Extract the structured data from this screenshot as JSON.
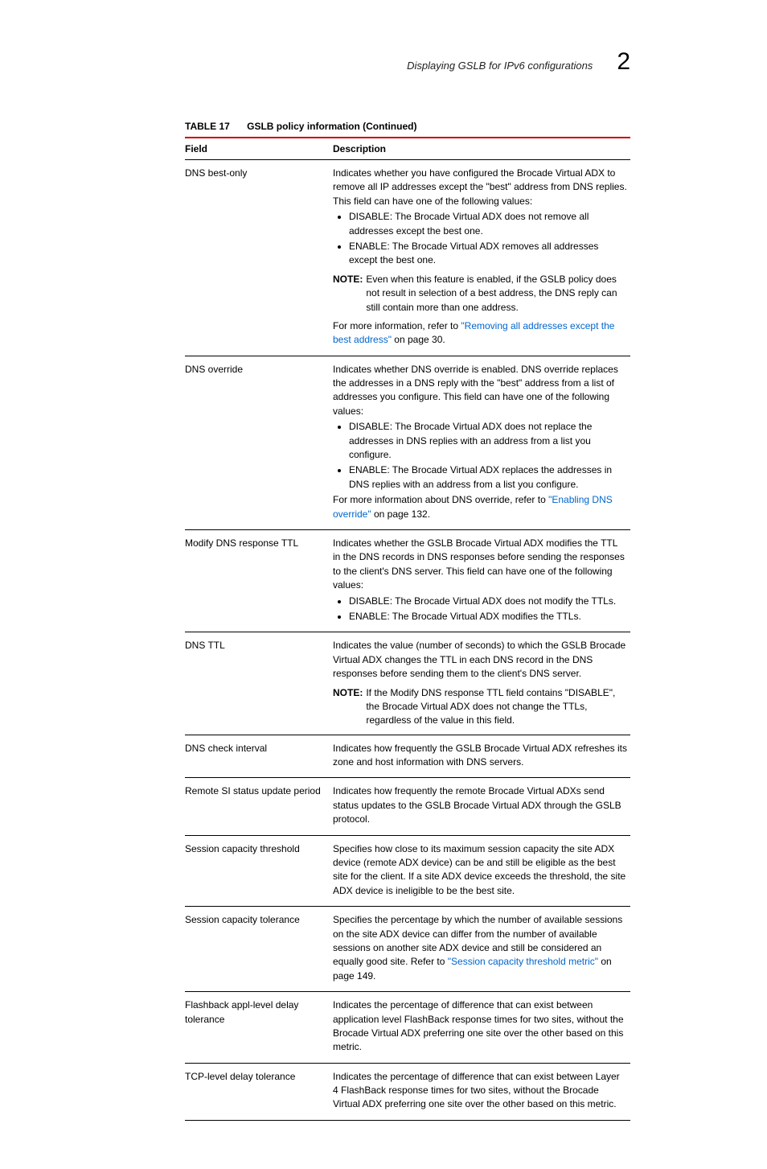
{
  "header": {
    "title": "Displaying GSLB for IPv6 configurations",
    "chapter": "2"
  },
  "caption": {
    "label": "TABLE 17",
    "text": "GSLB policy information (Continued)"
  },
  "columns": {
    "field": "Field",
    "desc": "Description"
  },
  "rows": {
    "r0": {
      "field": "DNS best-only",
      "p1": "Indicates whether you have configured the Brocade Virtual ADX to remove all IP addresses except the \"best\" address from DNS replies. This field can have one of the following values:",
      "b1": "DISABLE: The Brocade Virtual ADX does not remove all addresses except the best one.",
      "b2": "ENABLE: The Brocade Virtual ADX removes all addresses except the best one.",
      "note_label": "NOTE:",
      "note": "Even when this feature is enabled, if the GSLB policy does not result in selection of a best address, the DNS reply can still contain more than one address.",
      "p2a": "For more information, refer to ",
      "link": "\"Removing all addresses except the best address\"",
      "p2b": " on page 30."
    },
    "r1": {
      "field": "DNS override",
      "p1": "Indicates whether DNS override is enabled. DNS override replaces the addresses in a DNS reply with the \"best\" address from a list of addresses you configure. This field can have one of the following values:",
      "b1": "DISABLE: The Brocade Virtual ADX does not replace the addresses in DNS replies with an address from a list you configure.",
      "b2": "ENABLE: The Brocade Virtual ADX replaces the addresses in DNS replies with an address from a list you configure.",
      "p2a": "For more information about DNS override, refer to ",
      "link": "\"Enabling DNS override\"",
      "p2b": " on page 132."
    },
    "r2": {
      "field": "Modify DNS response TTL",
      "p1": "Indicates whether the GSLB Brocade Virtual ADX modifies the TTL in the DNS records in DNS responses before sending the responses to the client's DNS server. This field can have one of the following values:",
      "b1": "DISABLE: The Brocade Virtual ADX does not modify the TTLs.",
      "b2": "ENABLE: The Brocade Virtual ADX modifies the TTLs."
    },
    "r3": {
      "field": "DNS TTL",
      "p1": "Indicates the value (number of seconds) to which the GSLB Brocade Virtual ADX changes the TTL in each DNS record in the DNS responses before sending them to the client's DNS server.",
      "note_label": "NOTE:",
      "note": "If the Modify DNS response TTL field contains \"DISABLE\", the Brocade Virtual ADX does not change the TTLs, regardless of the value in this field."
    },
    "r4": {
      "field": "DNS check interval",
      "p1": "Indicates how frequently the GSLB Brocade Virtual ADX refreshes its zone and host information with DNS servers."
    },
    "r5": {
      "field": "Remote SI status update period",
      "p1": "Indicates how frequently the remote Brocade Virtual ADXs send status updates to the GSLB Brocade Virtual ADX through the GSLB protocol."
    },
    "r6": {
      "field": "Session capacity threshold",
      "p1": "Specifies how close to its maximum session capacity the site ADX device (remote ADX device) can be and still be eligible as the best site for the client. If a site ADX device exceeds the threshold, the site ADX device is ineligible to be the best site."
    },
    "r7": {
      "field": "Session capacity tolerance",
      "p1a": "Specifies the percentage by which the number of available sessions on the site ADX device can differ from the number of available sessions on another site ADX device and still be considered an equally good site. Refer to ",
      "link": "\"Session capacity threshold metric\"",
      "p1b": " on page 149."
    },
    "r8": {
      "field": "Flashback appl-level delay tolerance",
      "p1": "Indicates the percentage of difference that can exist between application level FlashBack response times for two sites, without the Brocade Virtual ADX preferring one site over the other based on this metric."
    },
    "r9": {
      "field": "TCP-level delay tolerance",
      "p1": "Indicates the percentage of difference that can exist between Layer 4 FlashBack response times for two sites, without the Brocade Virtual ADX preferring one site over the other based on this metric."
    }
  }
}
